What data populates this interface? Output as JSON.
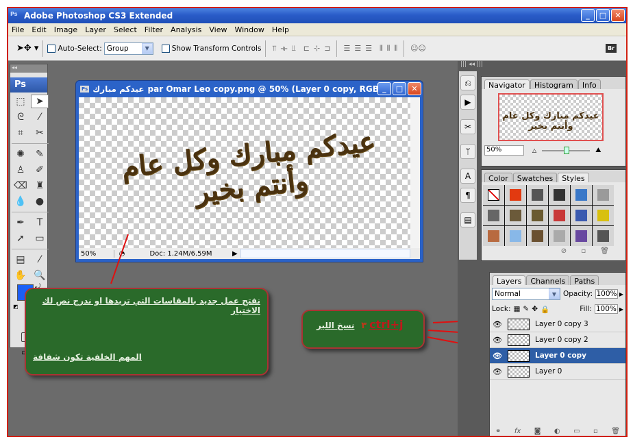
{
  "app": {
    "title": "Adobe Photoshop CS3 Extended",
    "icon": "ps-icon",
    "window_controls": {
      "minimize": "_",
      "maximize": "□",
      "close": "✕"
    }
  },
  "menu": [
    "File",
    "Edit",
    "Image",
    "Layer",
    "Select",
    "Filter",
    "Analysis",
    "View",
    "Window",
    "Help"
  ],
  "options_bar": {
    "tool_icon": "move-tool-icon",
    "auto_select_label": "Auto-Select:",
    "auto_select_checked": false,
    "auto_select_value": "Group",
    "show_transform_label": "Show Transform Controls",
    "show_transform_checked": false,
    "align_icons": [
      "align-top",
      "align-vcenter",
      "align-bottom",
      "align-left",
      "align-hcenter",
      "align-right"
    ],
    "distribute_icons": [
      "dist-top",
      "dist-vcenter",
      "dist-bottom",
      "dist-left",
      "dist-hcenter",
      "dist-right"
    ],
    "auto_align_icon": "auto-align-layers-icon",
    "bridge_label": "Br"
  },
  "toolbox": {
    "logo": "Ps",
    "tools": [
      {
        "name": "marquee",
        "glyph": "⬚"
      },
      {
        "name": "move",
        "glyph": "➤"
      },
      {
        "name": "lasso",
        "glyph": "ᘓ"
      },
      {
        "name": "magic-wand",
        "glyph": "⁄"
      },
      {
        "name": "crop",
        "glyph": "⌗"
      },
      {
        "name": "slice",
        "glyph": "✂"
      },
      {
        "name": "healing",
        "glyph": "✺"
      },
      {
        "name": "brush",
        "glyph": "✎"
      },
      {
        "name": "stamp",
        "glyph": "♙"
      },
      {
        "name": "history-brush",
        "glyph": "✐"
      },
      {
        "name": "eraser",
        "glyph": "⌫"
      },
      {
        "name": "paint-bucket",
        "glyph": "♜"
      },
      {
        "name": "blur",
        "glyph": "💧"
      },
      {
        "name": "dodge",
        "glyph": "●"
      },
      {
        "name": "pen",
        "glyph": "✒"
      },
      {
        "name": "type",
        "glyph": "T"
      },
      {
        "name": "path-selection",
        "glyph": "➚"
      },
      {
        "name": "rectangle",
        "glyph": "▭"
      },
      {
        "name": "notes",
        "glyph": "▤"
      },
      {
        "name": "eyedropper",
        "glyph": "⁄"
      },
      {
        "name": "hand",
        "glyph": "✋"
      },
      {
        "name": "zoom",
        "glyph": "🔍"
      }
    ],
    "foreground_color": "#1e5df0",
    "background_color": "#ffffff"
  },
  "document": {
    "title_arabic": "عيدكم مبارك",
    "title_rest": "par Omar Leo copy.png @ 50% (Layer 0 copy, RGB/8)",
    "canvas_text": "عيدكم مبارك وكل عام وأنتم بخير",
    "zoom": "50%",
    "doc_info": "Doc: 1.24M/6.59M"
  },
  "navigator": {
    "tabs": [
      "Navigator",
      "Histogram",
      "Info"
    ],
    "active_tab": "Navigator",
    "zoom": "50%",
    "zoom_slider_fraction": 0.45
  },
  "styles_panel": {
    "tabs": [
      "Color",
      "Swatches",
      "Styles"
    ],
    "active_tab": "Styles",
    "swatches": [
      "none",
      "#e23a10",
      "#555555",
      "#333333",
      "#3a78c8",
      "#9a9a9a",
      "#666666",
      "#6b5a3a",
      "#6a5a30",
      "#c83838",
      "#3a5ab0",
      "#d8c010",
      "#b86a40",
      "#88b8e8",
      "#6a5030",
      "#aaaaaa",
      "#6848a0",
      "#555555"
    ]
  },
  "layers_panel": {
    "tabs": [
      "Layers",
      "Channels",
      "Paths"
    ],
    "active_tab": "Layers",
    "blend_mode": "Normal",
    "opacity_label": "Opacity:",
    "opacity": "100%",
    "lock_label": "Lock:",
    "fill_label": "Fill:",
    "fill": "100%",
    "layers": [
      {
        "name": "Layer 0 copy 3",
        "visible": true,
        "selected": false
      },
      {
        "name": "Layer 0 copy 2",
        "visible": true,
        "selected": false
      },
      {
        "name": "Layer 0 copy",
        "visible": true,
        "selected": true
      },
      {
        "name": "Layer 0",
        "visible": true,
        "selected": false
      }
    ]
  },
  "annotations": {
    "note1_line1": "نفتح عمل جديد بالمقاسات التي تريدها او ندرج نص لك الاختيار",
    "note1_line2": "المهم الخلفية تكون شفافة",
    "note2_shortcut": "ctrl+j",
    "note2_text": "نسخ اللير",
    "note2_count": "٣"
  }
}
